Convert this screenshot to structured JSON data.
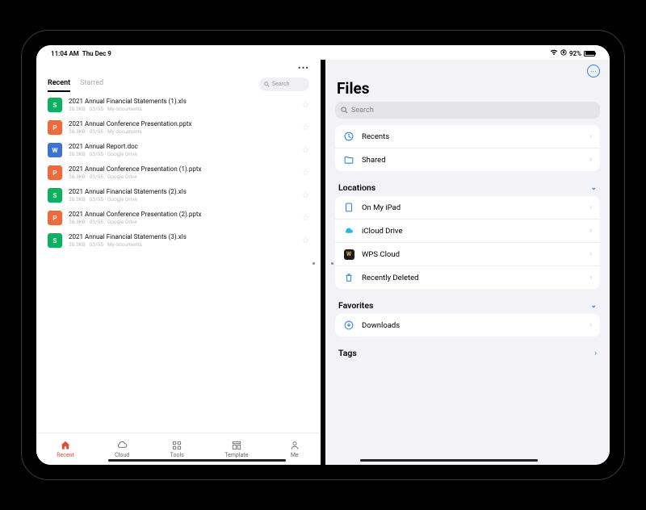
{
  "status": {
    "time": "11:04 AM",
    "date": "Thu Dec 9",
    "battery": "92%"
  },
  "wps": {
    "tabs": {
      "recent": "Recent",
      "starred": "Starred"
    },
    "search_placeholder": "Search",
    "files": [
      {
        "icon": "s",
        "name": "2021 Annual Financial Statements (1).xls",
        "meta": "20.3KB · 03/05 · My documents"
      },
      {
        "icon": "p",
        "name": "2021 Annual Conference Presentation.pptx",
        "meta": "20.3KB · 03/05 · My documents"
      },
      {
        "icon": "w",
        "name": "2021 Annual Report.doc",
        "meta": "20.3KB · 03/05 · Google Drive"
      },
      {
        "icon": "p",
        "name": "2021 Annual Conference Presentation (1).pptx",
        "meta": "20.3KB · 03/05 · Google Drive"
      },
      {
        "icon": "s",
        "name": "2021 Annual Financial Statements (2).xls",
        "meta": "20.3KB · 03/05 · Google Drive"
      },
      {
        "icon": "p",
        "name": "2021 Annual Conference Presentation (2).pptx",
        "meta": "20.3KB · 03/05 · Google Drive"
      },
      {
        "icon": "s",
        "name": "2021 Annual Financial Statements (3).xls",
        "meta": "20.3KB · 03/05 · My documents"
      }
    ],
    "tabbar": {
      "recent": "Recent",
      "cloud": "Cloud",
      "tools": "Tools",
      "template": "Template",
      "me": "Me"
    }
  },
  "files_app": {
    "title": "Files",
    "search_placeholder": "Search",
    "quick": {
      "recents": "Recents",
      "shared": "Shared"
    },
    "locations": {
      "header": "Locations",
      "items": {
        "ipad": "On My iPad",
        "icloud": "iCloud Drive",
        "wps": "WPS Cloud",
        "deleted": "Recently Deleted"
      }
    },
    "favorites": {
      "header": "Favorites",
      "downloads": "Downloads"
    },
    "tags": {
      "header": "Tags"
    }
  },
  "icon_letters": {
    "s": "S",
    "p": "P",
    "w": "W"
  }
}
